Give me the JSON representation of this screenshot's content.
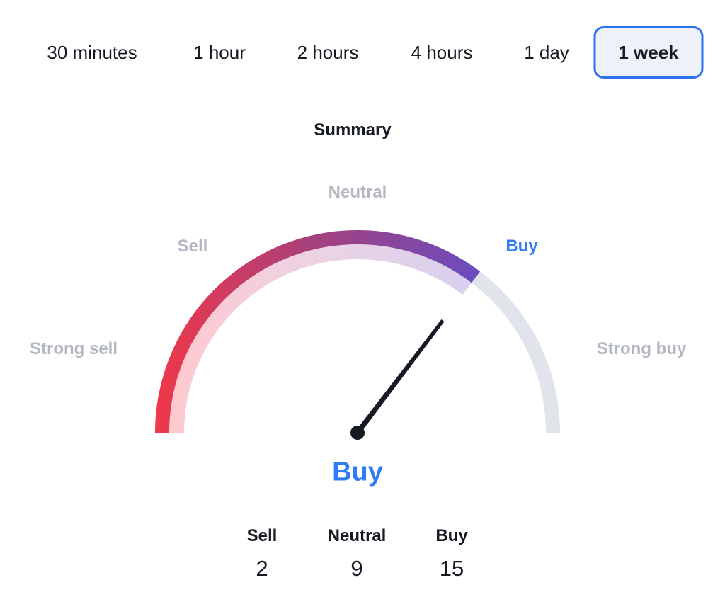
{
  "tabs": [
    {
      "label": "30 minutes",
      "active": false
    },
    {
      "label": "1 hour",
      "active": false
    },
    {
      "label": "2 hours",
      "active": false
    },
    {
      "label": "4 hours",
      "active": false
    },
    {
      "label": "1 day",
      "active": false
    },
    {
      "label": "1 week",
      "active": true
    }
  ],
  "summary": {
    "title": "Summary",
    "gauge": {
      "labels": {
        "strong_sell": "Strong sell",
        "sell": "Sell",
        "neutral": "Neutral",
        "buy": "Buy",
        "strong_buy": "Strong buy"
      },
      "active_label": "buy",
      "value_fraction": 0.707,
      "colors": {
        "gradient_start": "#f0384a",
        "gradient_mid": "#a3417e",
        "gradient_end": "#6a4cc0",
        "inner_start": "#fec9cf",
        "inner_end": "#d8d0ee",
        "track": "#e1e4eb",
        "needle": "#151a23",
        "label_inactive": "#b3b7c1",
        "label_active": "#2f7cf6"
      }
    },
    "verdict": "Buy",
    "counts": [
      {
        "label": "Sell",
        "value": "2"
      },
      {
        "label": "Neutral",
        "value": "9"
      },
      {
        "label": "Buy",
        "value": "15"
      }
    ]
  }
}
